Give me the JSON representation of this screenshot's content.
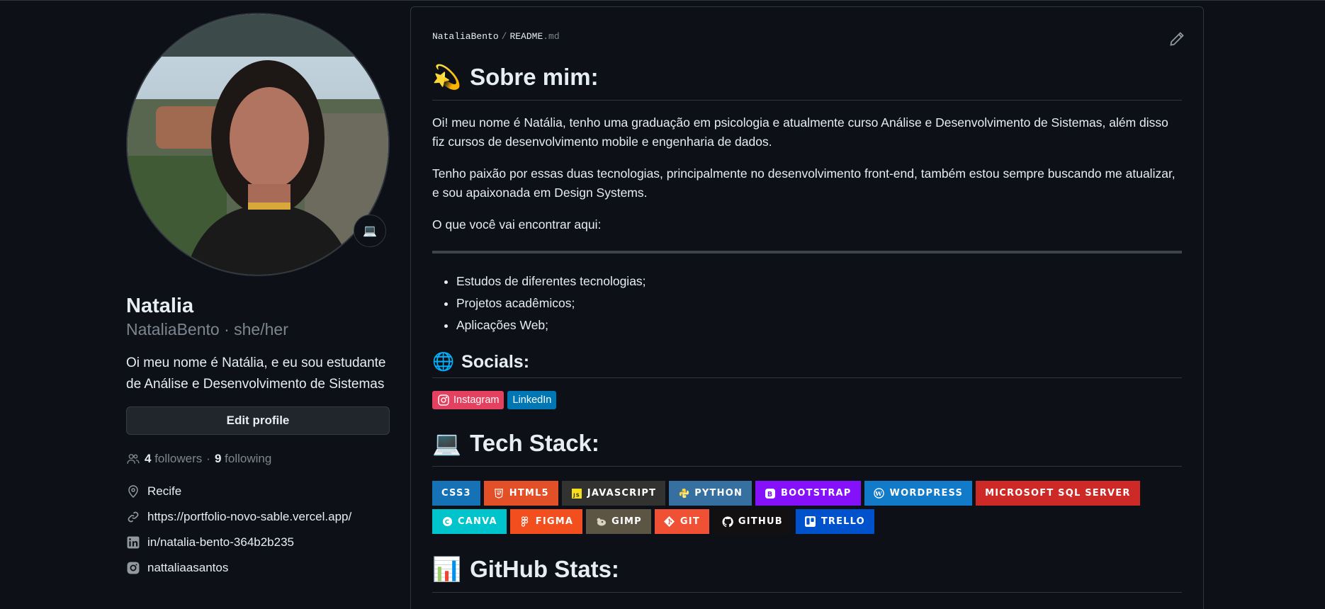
{
  "profile": {
    "name": "Natalia",
    "login_line": "NataliaBento · she/her",
    "status_emoji": "💻",
    "bio": "Oi meu nome é Natália, e eu sou estudante de Análise e Desenvolvimento de Sistemas",
    "edit_label": "Edit profile",
    "followers_count": "4",
    "followers_label": "followers",
    "following_count": "9",
    "following_label": "following",
    "dot": "·",
    "location": "Recife",
    "website": "https://portfolio-novo-sable.vercel.app/",
    "linkedin": "in/natalia-bento-364b2b235",
    "instagram": "nattaliaasantos"
  },
  "readme": {
    "path_user": "NataliaBento",
    "path_sep": "/",
    "path_file": "README",
    "path_ext": ".md",
    "about": {
      "emoji": "💫",
      "title": "Sobre mim:",
      "p1": "Oi! meu nome é Natália, tenho uma graduação em psicologia e atualmente curso Análise e Desenvolvimento de Sistemas, além disso fiz cursos de desenvolvimento mobile e engenharia de dados.",
      "p2": "Tenho paixão por essas duas tecnologias, principalmente no desenvolvimento front-end, também estou sempre buscando me atualizar, e sou apaixonada em Design Systems.",
      "p3": "O que você vai encontrar aqui:",
      "items": [
        "Estudos de diferentes tecnologias;",
        "Projetos acadêmicos;",
        "Aplicações Web;"
      ]
    },
    "socials": {
      "emoji": "🌐",
      "title": "Socials:",
      "instagram_label": "Instagram",
      "linkedin_label": "LinkedIn",
      "instagram_color": "#e4405f",
      "linkedin_color": "#0077b5"
    },
    "tech": {
      "emoji": "💻",
      "title": "Tech Stack:",
      "badges": [
        {
          "label": "CSS3",
          "color": "#1572b6",
          "icon": "css3-icon"
        },
        {
          "label": "HTML5",
          "color": "#e34f26",
          "icon": "html5-icon"
        },
        {
          "label": "JAVASCRIPT",
          "color": "#323330",
          "icon": "javascript-icon"
        },
        {
          "label": "PYTHON",
          "color": "#3670a0",
          "icon": "python-icon"
        },
        {
          "label": "BOOTSTRAP",
          "color": "#8511fa",
          "icon": "bootstrap-icon"
        },
        {
          "label": "WORDPRESS",
          "color": "#117ac9",
          "icon": "wordpress-icon"
        },
        {
          "label": "MICROSOFT SQL SERVER",
          "color": "#cc2927",
          "icon": "none"
        },
        {
          "label": "CANVA",
          "color": "#00c4cc",
          "icon": "canva-icon"
        },
        {
          "label": "FIGMA",
          "color": "#f24e1e",
          "icon": "figma-icon"
        },
        {
          "label": "GIMP",
          "color": "#5c5543",
          "icon": "gimp-icon"
        },
        {
          "label": "GIT",
          "color": "#f05033",
          "icon": "git-icon"
        },
        {
          "label": "GITHUB",
          "color": "#121011",
          "icon": "github-icon"
        },
        {
          "label": "TRELLO",
          "color": "#0052cc",
          "icon": "trello-icon"
        }
      ]
    },
    "stats": {
      "emoji": "📊",
      "title": "GitHub Stats:"
    }
  }
}
